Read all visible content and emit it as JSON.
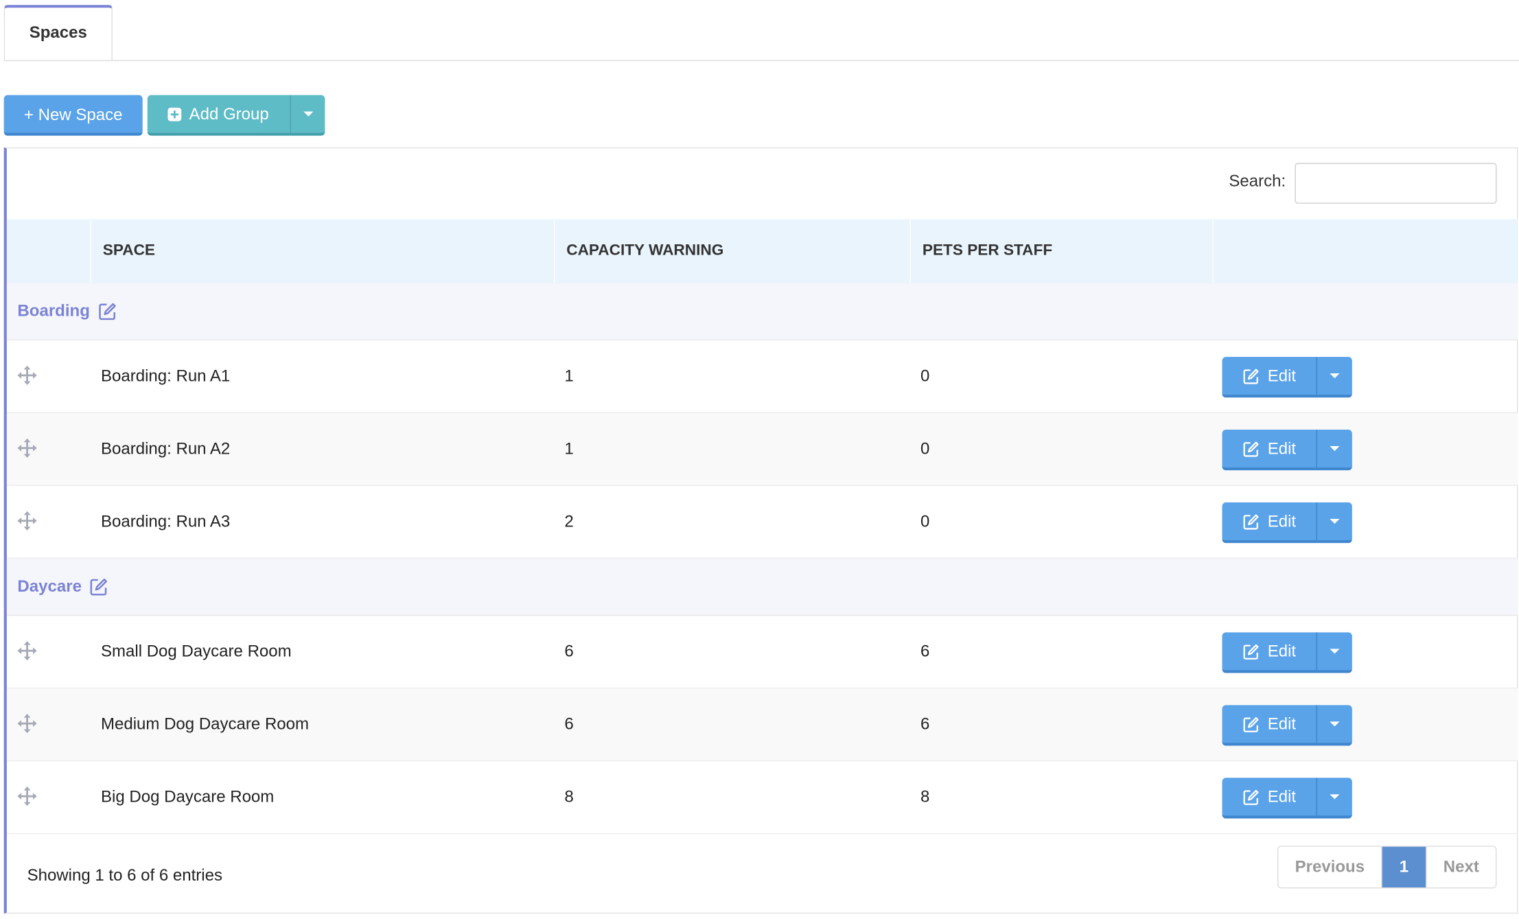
{
  "tabs": [
    {
      "label": "Spaces",
      "active": true
    }
  ],
  "toolbar": {
    "new_space_label": "+ New Space",
    "add_group_label": "Add Group"
  },
  "search": {
    "label": "Search:",
    "value": "",
    "placeholder": ""
  },
  "table": {
    "columns": [
      "",
      "SPACE",
      "CAPACITY WARNING",
      "PETS PER STAFF",
      ""
    ],
    "edit_label": "Edit",
    "groups": [
      {
        "name": "Boarding",
        "rows": [
          {
            "space": "Boarding: Run A1",
            "capacity_warning": "1",
            "pets_per_staff": "0"
          },
          {
            "space": "Boarding: Run A2",
            "capacity_warning": "1",
            "pets_per_staff": "0"
          },
          {
            "space": "Boarding: Run A3",
            "capacity_warning": "2",
            "pets_per_staff": "0"
          }
        ]
      },
      {
        "name": "Daycare",
        "rows": [
          {
            "space": "Small Dog Daycare Room",
            "capacity_warning": "6",
            "pets_per_staff": "6"
          },
          {
            "space": "Medium Dog Daycare Room",
            "capacity_warning": "6",
            "pets_per_staff": "6"
          },
          {
            "space": "Big Dog Daycare Room",
            "capacity_warning": "8",
            "pets_per_staff": "8"
          }
        ]
      }
    ]
  },
  "footer": {
    "info": "Showing 1 to 6 of 6 entries"
  },
  "pagination": {
    "previous": "Previous",
    "current": "1",
    "next": "Next"
  },
  "colors": {
    "accent_purple": "#7b83d4",
    "button_blue": "#5aa3e8",
    "button_teal": "#5ebcc6",
    "header_bg": "#eaf4fc"
  },
  "icons": {
    "move": "move-arrows-icon",
    "edit": "edit-square-icon",
    "add": "plus-square-icon",
    "caret": "caret-down-icon"
  }
}
